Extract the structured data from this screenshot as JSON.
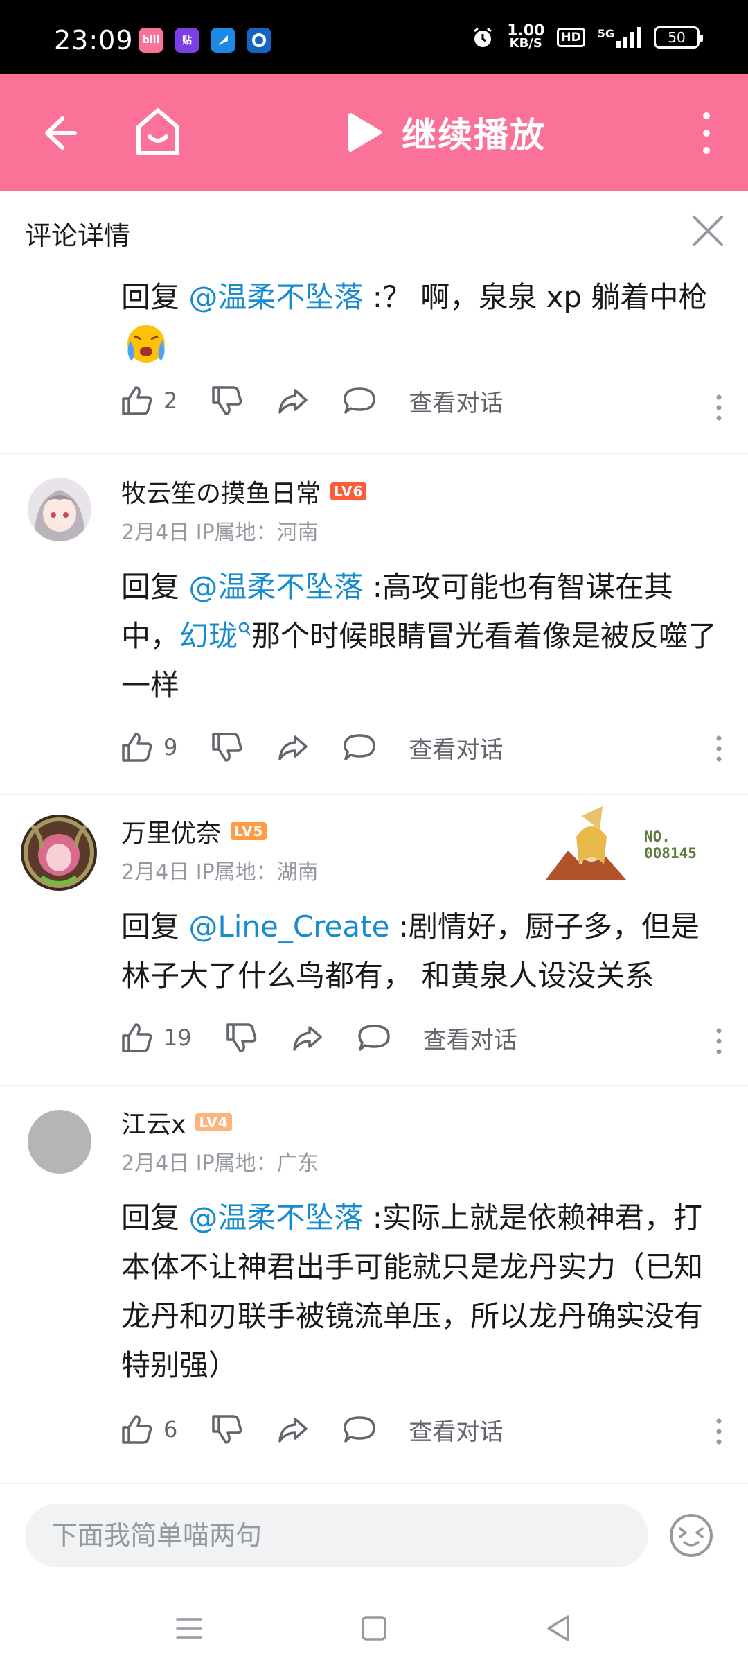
{
  "status_bar": {
    "time": "23:09",
    "app_icons": [
      {
        "name": "bilibili-app-icon",
        "label": "bili",
        "color": "#fb7299"
      },
      {
        "name": "tieba-app-icon",
        "label": "贴",
        "color": "#7b3fe4"
      },
      {
        "name": "blue-app-icon",
        "label": "",
        "color": "#1e88e5"
      },
      {
        "name": "circle-app-icon",
        "label": "",
        "color": "#1565c0"
      }
    ],
    "net_speed": "1.00",
    "net_unit": "KB/S",
    "hd": "HD",
    "network": "5G",
    "battery": "50"
  },
  "top_bar": {
    "play_label": "继续播放",
    "color": "#fb7299"
  },
  "sheet": {
    "title": "评论详情"
  },
  "comments": [
    {
      "reply_prefix": "回复 ",
      "mention": "@温柔不坠落",
      "text": " :？ 啊，泉泉 xp 躺着中枪",
      "likes": "2",
      "view_dialog": "查看对话"
    },
    {
      "username": "牧云笙の摸鱼日常",
      "level": "LV6",
      "level_color": "#fb5c3a",
      "date": "2月4日",
      "ip": "IP属地：河南",
      "reply_prefix": "回复 ",
      "mention": "@温柔不坠落",
      "text_a": " :高攻可能也有智谋在其中，",
      "link": "幻珑",
      "text_b": "那个时候眼睛冒光看着像是被反噬了一样",
      "likes": "9",
      "view_dialog": "查看对话"
    },
    {
      "username": "万里优奈",
      "level": "LV5",
      "level_color": "#ff9b42",
      "date": "2月4日",
      "ip": "IP属地：湖南",
      "badge_no": "NO.",
      "badge_num": "008145",
      "reply_prefix": "回复 ",
      "mention": "@Line_Create",
      "text": " :剧情好，厨子多，但是林子大了什么鸟都有， 和黄泉人设没关系",
      "likes": "19",
      "view_dialog": "查看对话"
    },
    {
      "username": "江云x",
      "level": "LV4",
      "level_color": "#ffb37c",
      "date": "2月4日",
      "ip": "IP属地：广东",
      "reply_prefix": "回复 ",
      "mention": "@温柔不坠落",
      "text": " :实际上就是依赖神君，打本体不让神君出手可能就只是龙丹实力（已知龙丹和刃联手被镜流单压，所以龙丹确实没有特别强）",
      "likes": "6",
      "view_dialog": "查看对话"
    }
  ],
  "input": {
    "placeholder": "下面我简单喵两句"
  }
}
